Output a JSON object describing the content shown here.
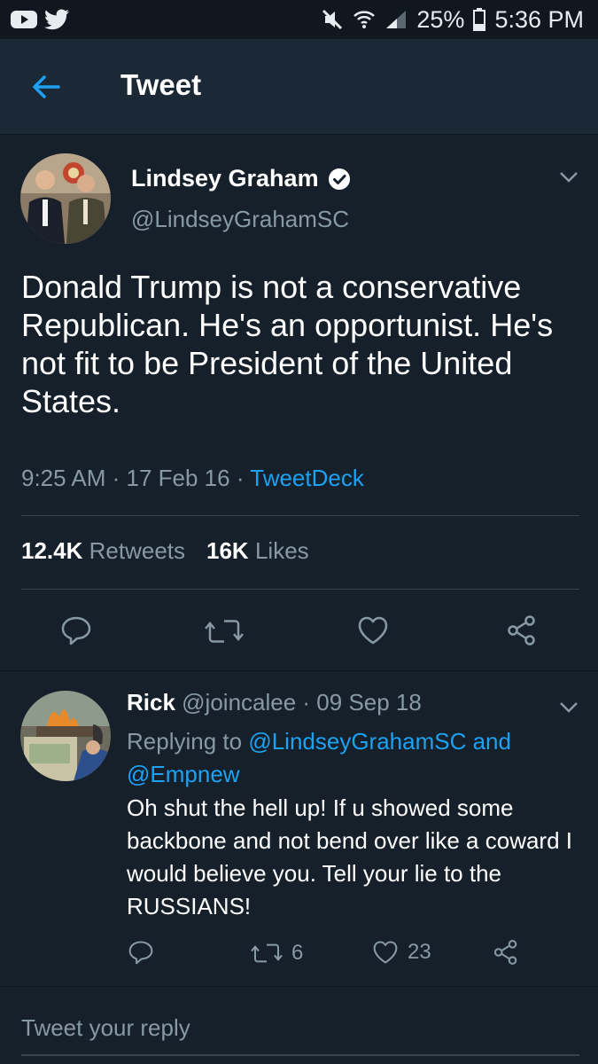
{
  "status_bar": {
    "battery": "25%",
    "time": "5:36 PM",
    "left_icons": [
      "youtube-icon",
      "twitter-icon"
    ],
    "right_icons": [
      "mute-icon",
      "wifi-icon",
      "signal-icon",
      "battery-icon"
    ]
  },
  "header": {
    "title": "Tweet"
  },
  "tweet": {
    "author_name": "Lindsey Graham",
    "handle": "@LindseyGrahamSC",
    "verified": true,
    "text": "Donald Trump is not a conservative Republican. He's an opportunist. He's not fit to be President of the United States.",
    "time": "9:25 AM",
    "sep1": " · ",
    "date": "17 Feb 16",
    "sep2": " · ",
    "source": "TweetDeck",
    "retweets_count": "12.4K",
    "retweets_label": "Retweets",
    "likes_count": "16K",
    "likes_label": "Likes"
  },
  "reply": {
    "name": "Rick",
    "handle": "@joincalee",
    "sep": " · ",
    "date": "09 Sep 18",
    "replying_prefix": "Replying to ",
    "replying_to": "@LindseyGrahamSC and @Empnew",
    "text": "Oh shut the hell up! If u showed some backbone and not bend over like a coward I would believe you. Tell your lie to the RUSSIANS!",
    "retweets": "6",
    "likes": "23"
  },
  "compose": {
    "placeholder": "Tweet your reply"
  },
  "colors": {
    "background": "#15202b",
    "header": "#1b2836",
    "accent": "#1da1f2",
    "secondary_text": "#8899a6",
    "divider": "#38444d"
  }
}
